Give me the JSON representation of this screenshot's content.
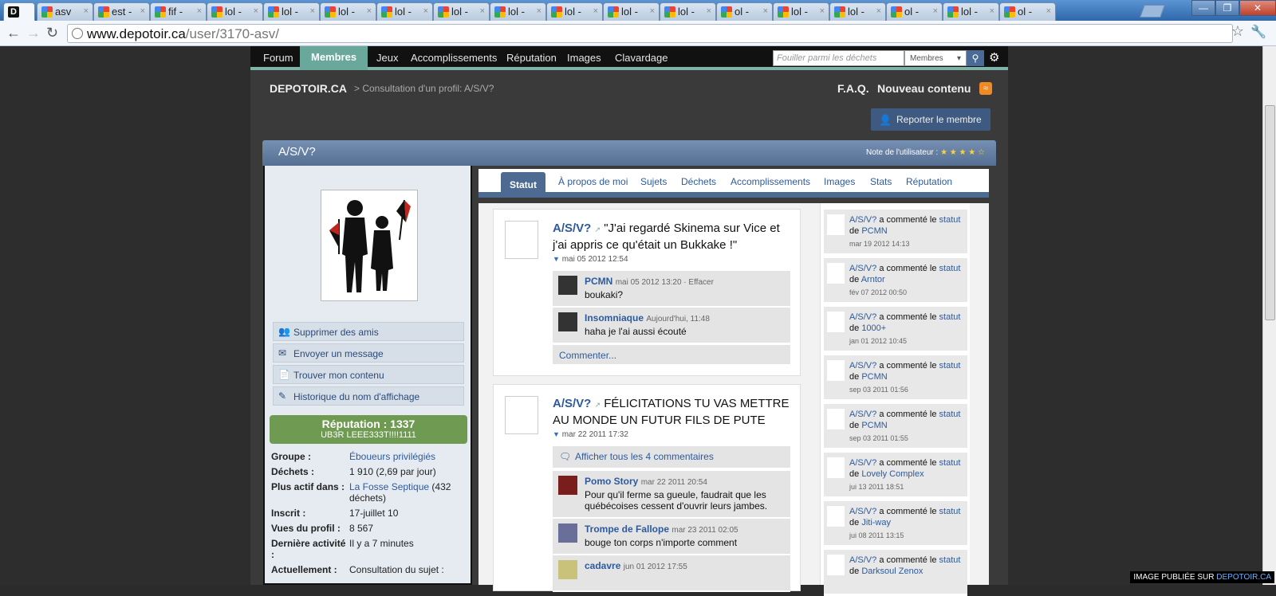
{
  "browser": {
    "tabs": [
      {
        "label": ""
      },
      {
        "label": "asv"
      },
      {
        "label": "est -"
      },
      {
        "label": "fif -"
      },
      {
        "label": "lol -"
      },
      {
        "label": "lol -"
      },
      {
        "label": "lol -"
      },
      {
        "label": "lol -"
      },
      {
        "label": "lol -"
      },
      {
        "label": "lol -"
      },
      {
        "label": "lol -"
      },
      {
        "label": "lol -"
      },
      {
        "label": "lol -"
      },
      {
        "label": "ol -"
      },
      {
        "label": "lol -"
      },
      {
        "label": "lol -"
      },
      {
        "label": "ol -"
      },
      {
        "label": "lol -"
      },
      {
        "label": "ol -"
      }
    ],
    "url_host": "www.depotoir.ca",
    "url_path": "/user/3170-asv/"
  },
  "nav": {
    "items": [
      "Forum",
      "Membres",
      "Jeux",
      "Accomplissements",
      "Réputation",
      "Images",
      "Clavardage"
    ],
    "search_placeholder": "Fouiller parmi les déchets",
    "search_scope": "Membres"
  },
  "header": {
    "site": "DEPOTOIR.CA",
    "breadcrumb": "> Consultation d'un profil: A/S/V?",
    "faq": "F.A.Q.",
    "new_content": "Nouveau contenu",
    "report": "Reporter le membre"
  },
  "profile": {
    "name": "A/S/V?",
    "rating_label": "Note de l'utilisateur :",
    "rating": 4,
    "rating_max": 5,
    "actions": [
      "Supprimer des amis",
      "Envoyer un message",
      "Trouver mon contenu",
      "Historique du nom d'affichage"
    ],
    "reputation_title": "Réputation : 1337",
    "reputation_sub": "UB3R LEEE333T!!!!1111",
    "info": [
      {
        "k": "Groupe :",
        "v": "Éboueurs privilégiés",
        "link": true
      },
      {
        "k": "Déchets :",
        "v": "1 910 (2,69 par jour)",
        "link": false
      },
      {
        "k": "Plus actif dans :",
        "v": "La Fosse Septique",
        "v2": " (432 déchets)",
        "link": true
      },
      {
        "k": "Inscrit :",
        "v": "17-juillet 10",
        "link": false
      },
      {
        "k": "Vues du profil :",
        "v": "8 567",
        "link": false
      },
      {
        "k": "Dernière activité :",
        "v": "Il y a 7 minutes",
        "link": false
      },
      {
        "k": "Actuellement :",
        "v": "Consultation du sujet :",
        "link": false
      }
    ]
  },
  "tabs": [
    "Statut",
    "À propos de moi",
    "Sujets",
    "Déchets",
    "Accomplissements",
    "Images",
    "Stats",
    "Réputation"
  ],
  "posts": [
    {
      "author": "A/S/V?",
      "text": "\"J'ai regardé Skinema sur Vice et j'ai appris ce qu'était un Bukkake !\"",
      "date": "mai 05 2012 12:54",
      "comments": [
        {
          "name": "PCMN",
          "meta": "mai 05 2012 13:20 · Effacer",
          "text": "boukaki?"
        },
        {
          "name": "Insomniaque",
          "meta": "Aujourd'hui, 11:48",
          "text": "haha je l'ai aussi écouté"
        }
      ],
      "comment_action": "Commenter..."
    },
    {
      "author": "A/S/V?",
      "text": "FÉLICITATIONS TU VAS METTRE AU MONDE UN FUTUR FILS DE PUTE",
      "date": "mar 22 2011 17:32",
      "show_all": "Afficher tous les 4 commentaires",
      "comments": [
        {
          "name": "Pomo Story",
          "meta": "mar 22 2011 20:54",
          "text": "Pour qu'il ferme sa gueule, faudrait que les québécoises cessent d'ouvrir leurs jambes."
        },
        {
          "name": "Trompe de Fallope",
          "meta": "mar 23 2011 02:05",
          "text": "bouge ton corps n'importe comment"
        },
        {
          "name": "cadavre",
          "meta": "jun 01 2012 17:55",
          "text": ""
        }
      ]
    }
  ],
  "sidefeed": {
    "verb": "a commenté le",
    "obj": "statut",
    "de": "de",
    "items": [
      {
        "who": "A/S/V?",
        "target": "PCMN",
        "date": "mar 19 2012 14:13"
      },
      {
        "who": "A/S/V?",
        "target": "Arntor",
        "date": "fév 07 2012 00:50"
      },
      {
        "who": "A/S/V?",
        "target": "1000+",
        "date": "jan 01 2012 10:45"
      },
      {
        "who": "A/S/V?",
        "target": "PCMN",
        "date": "sep 03 2011 01:56"
      },
      {
        "who": "A/S/V?",
        "target": "PCMN",
        "date": "sep 03 2011 01:55"
      },
      {
        "who": "A/S/V?",
        "target": "Lovely Complex",
        "date": "jui 13 2011 18:51"
      },
      {
        "who": "A/S/V?",
        "target": "Jiti-way",
        "date": "jui 08 2011 13:15"
      },
      {
        "who": "A/S/V?",
        "target": "Darksoul Zenox",
        "date": ""
      }
    ]
  },
  "watermark": {
    "prefix": "IMAGE PUBLIÉE SUR ",
    "site": "DEPOTOIR.CA"
  }
}
